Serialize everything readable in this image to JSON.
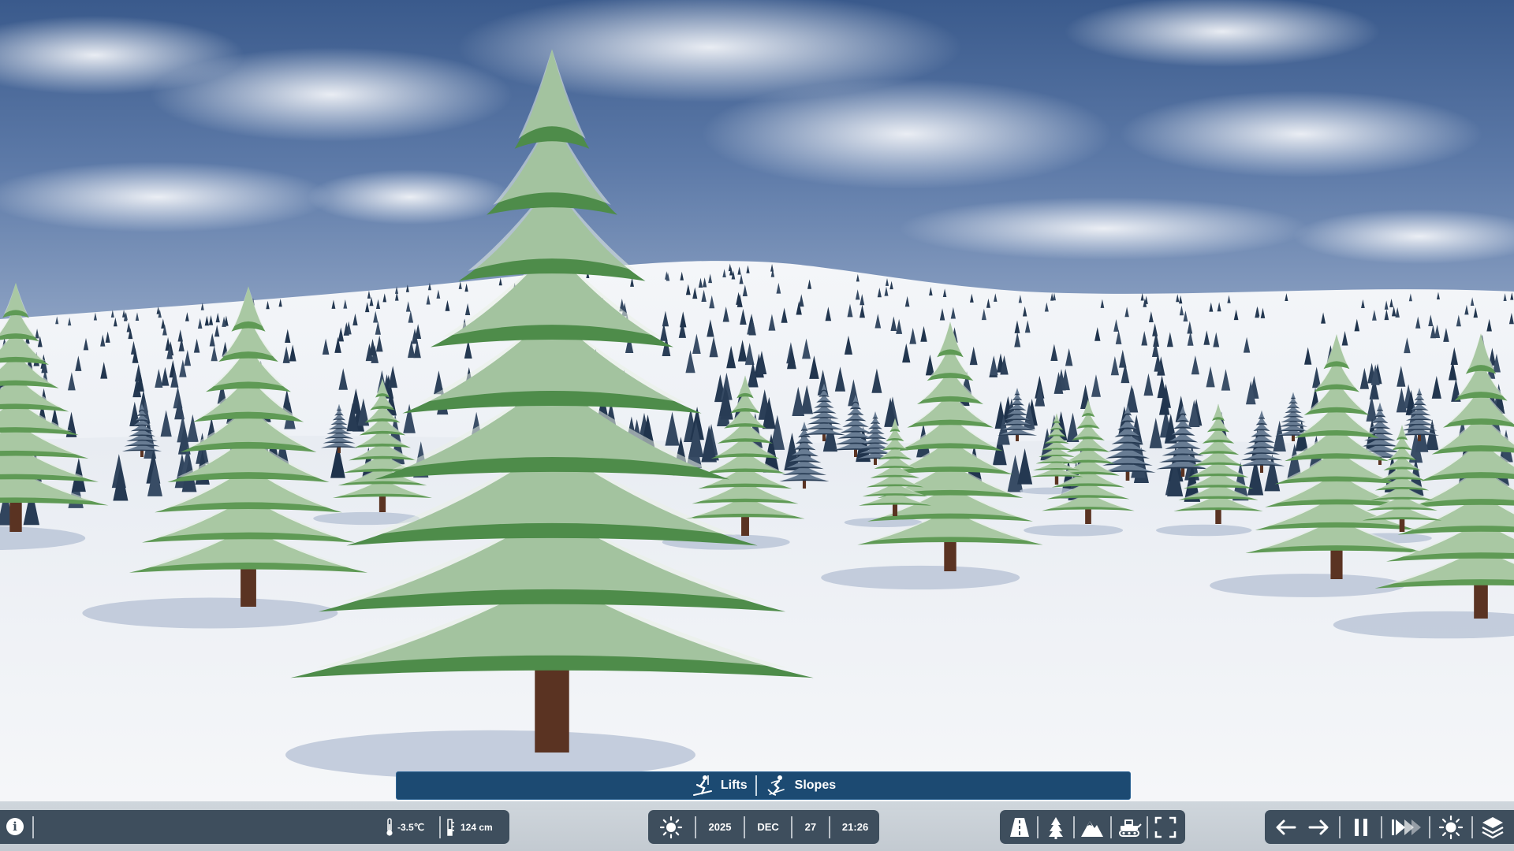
{
  "build_menu": {
    "lifts_label": "Lifts",
    "slopes_label": "Slopes"
  },
  "status": {
    "temperature": "-3.5℃",
    "snow_depth": "124 cm"
  },
  "date": {
    "year": "2025",
    "month": "DEC",
    "day": "27",
    "time": "21:26"
  },
  "colors": {
    "build_bar_bg": "#1c4a72",
    "panel_bg": "#3e4e5d",
    "strip_bg": "#c8cfd5",
    "sky_top": "#2e4a78",
    "snow": "#f2f4f7",
    "tree_green": "#4e8c4a"
  },
  "icons": {
    "info": "info-icon",
    "thermometer": "thermometer-icon",
    "snow_depth": "snow-depth-icon",
    "sun": "sun-icon",
    "road": "road-icon",
    "tree": "tree-icon",
    "mountain": "mountain-icon",
    "groomer": "snow-groomer-icon",
    "fullscreen": "fullscreen-icon",
    "arrow_left": "arrow-left-icon",
    "arrow_right": "arrow-right-icon",
    "pause": "pause-icon",
    "fast_forward": "fast-forward-icon",
    "brightness": "brightness-icon",
    "layers": "layers-icon"
  }
}
